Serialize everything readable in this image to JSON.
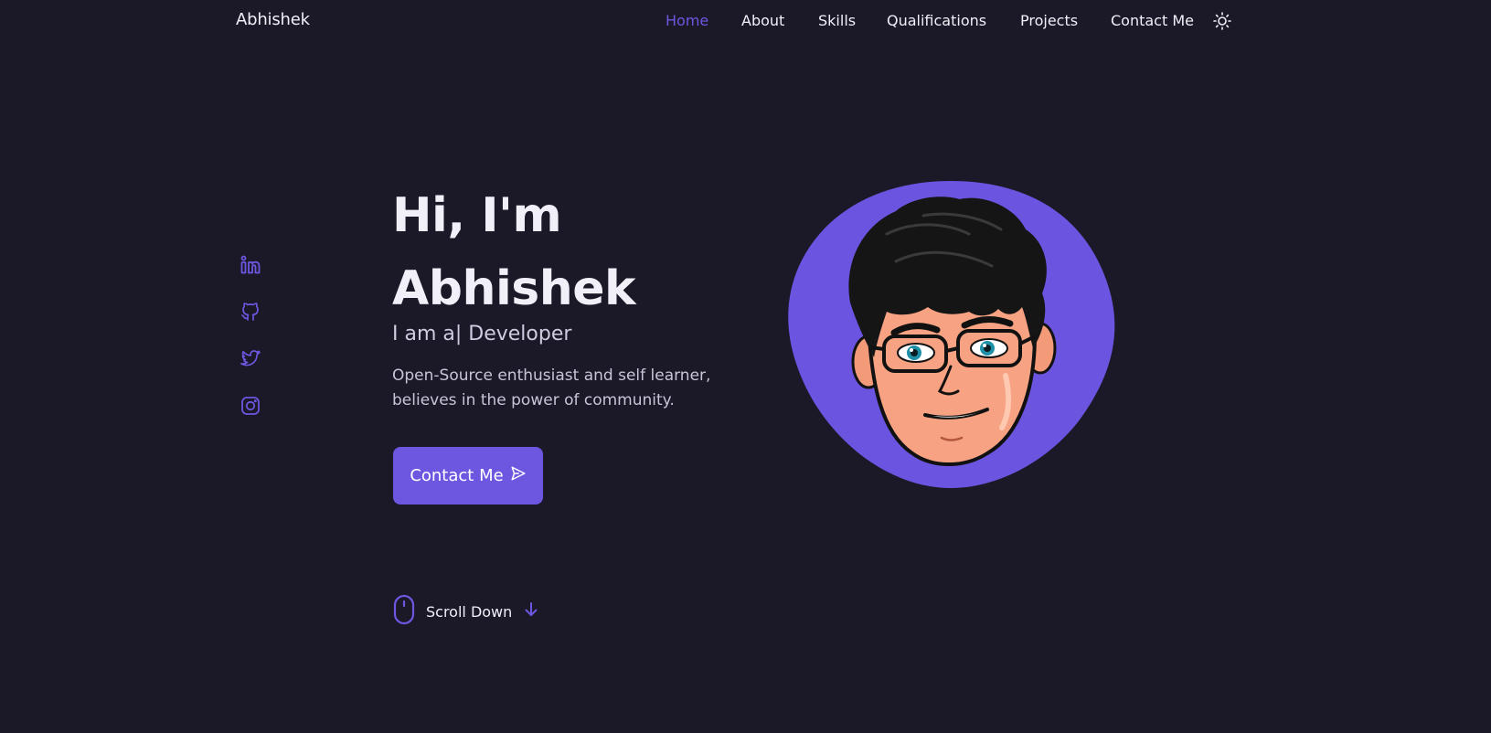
{
  "header": {
    "logo": "Abhishek",
    "nav": [
      {
        "label": "Home",
        "active": true
      },
      {
        "label": "About",
        "active": false
      },
      {
        "label": "Skills",
        "active": false
      },
      {
        "label": "Qualifications",
        "active": false
      },
      {
        "label": "Projects",
        "active": false
      },
      {
        "label": "Contact Me",
        "active": false
      }
    ],
    "theme_toggle_icon": "sun-icon"
  },
  "social": [
    {
      "icon": "linkedin-icon"
    },
    {
      "icon": "github-icon"
    },
    {
      "icon": "twitter-icon"
    },
    {
      "icon": "instagram-icon"
    }
  ],
  "hero": {
    "title_line1": "Hi, I'm",
    "title_line2": "Abhishek",
    "subtitle": "I am a| Developer",
    "description_line1": "Open-Source enthusiast and self learner,",
    "description_line2": "believes in the power of community.",
    "cta_label": "Contact Me",
    "cta_icon": "send-icon",
    "scroll_label": "Scroll Down",
    "scroll_icon": "mouse-icon",
    "scroll_arrow_icon": "arrow-down-icon"
  },
  "colors": {
    "background": "#1b1828",
    "accent": "#6e57e0",
    "text": "#f1eff7"
  }
}
